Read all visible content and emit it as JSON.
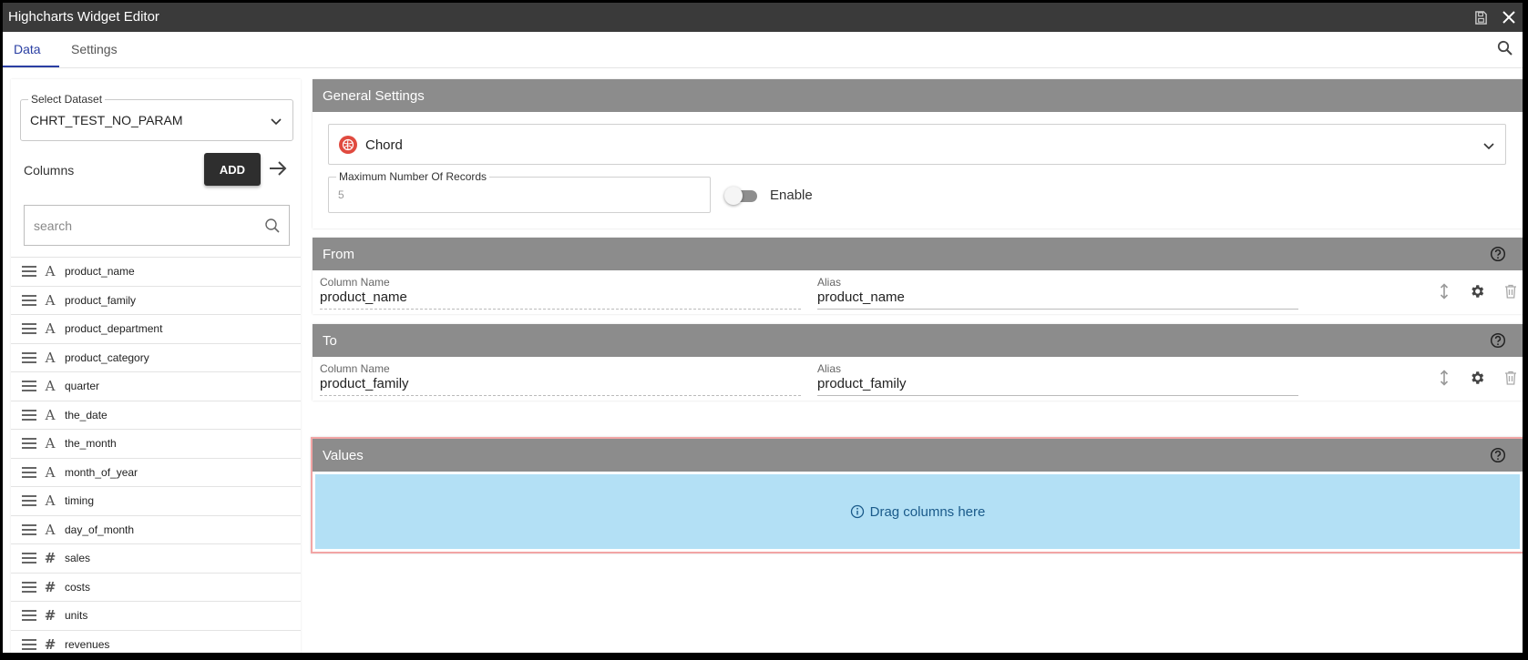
{
  "window": {
    "title": "Highcharts Widget Editor",
    "icons": [
      "save-icon",
      "close-icon"
    ]
  },
  "tabs": [
    {
      "label": "Data",
      "active": true
    },
    {
      "label": "Settings",
      "active": false
    }
  ],
  "left_panel": {
    "dataset": {
      "label": "Select Dataset",
      "value": "CHRT_TEST_NO_PARAM"
    },
    "columns_label": "Columns",
    "add_button": "ADD",
    "search_placeholder": "search",
    "columns": [
      {
        "name": "product_name",
        "type": "text"
      },
      {
        "name": "product_family",
        "type": "text"
      },
      {
        "name": "product_department",
        "type": "text"
      },
      {
        "name": "product_category",
        "type": "text"
      },
      {
        "name": "quarter",
        "type": "text"
      },
      {
        "name": "the_date",
        "type": "text"
      },
      {
        "name": "the_month",
        "type": "text"
      },
      {
        "name": "month_of_year",
        "type": "text"
      },
      {
        "name": "timing",
        "type": "text"
      },
      {
        "name": "day_of_month",
        "type": "text"
      },
      {
        "name": "sales",
        "type": "number"
      },
      {
        "name": "costs",
        "type": "number"
      },
      {
        "name": "units",
        "type": "number"
      },
      {
        "name": "revenues",
        "type": "number"
      }
    ],
    "type_glyphs": {
      "text": "A",
      "number": "#"
    }
  },
  "general_settings": {
    "title": "General Settings",
    "chart_type": "Chord",
    "max_records": {
      "label": "Maximum Number Of Records",
      "value": "5"
    },
    "toggle": {
      "label": "Enable",
      "on": false
    }
  },
  "from": {
    "title": "From",
    "column_name_label": "Column Name",
    "column_name": "product_name",
    "alias_label": "Alias",
    "alias": "product_name"
  },
  "to": {
    "title": "To",
    "column_name_label": "Column Name",
    "column_name": "product_family",
    "alias_label": "Alias",
    "alias": "product_family"
  },
  "values": {
    "title": "Values",
    "dropzone_text": "Drag columns here"
  },
  "colors": {
    "titlebar": "#3a3a3a",
    "accent": "#2a3fa3",
    "panel_header": "#8c8c8c",
    "dropzone": "#b3e0f5",
    "error_border": "#f2a5a5"
  }
}
